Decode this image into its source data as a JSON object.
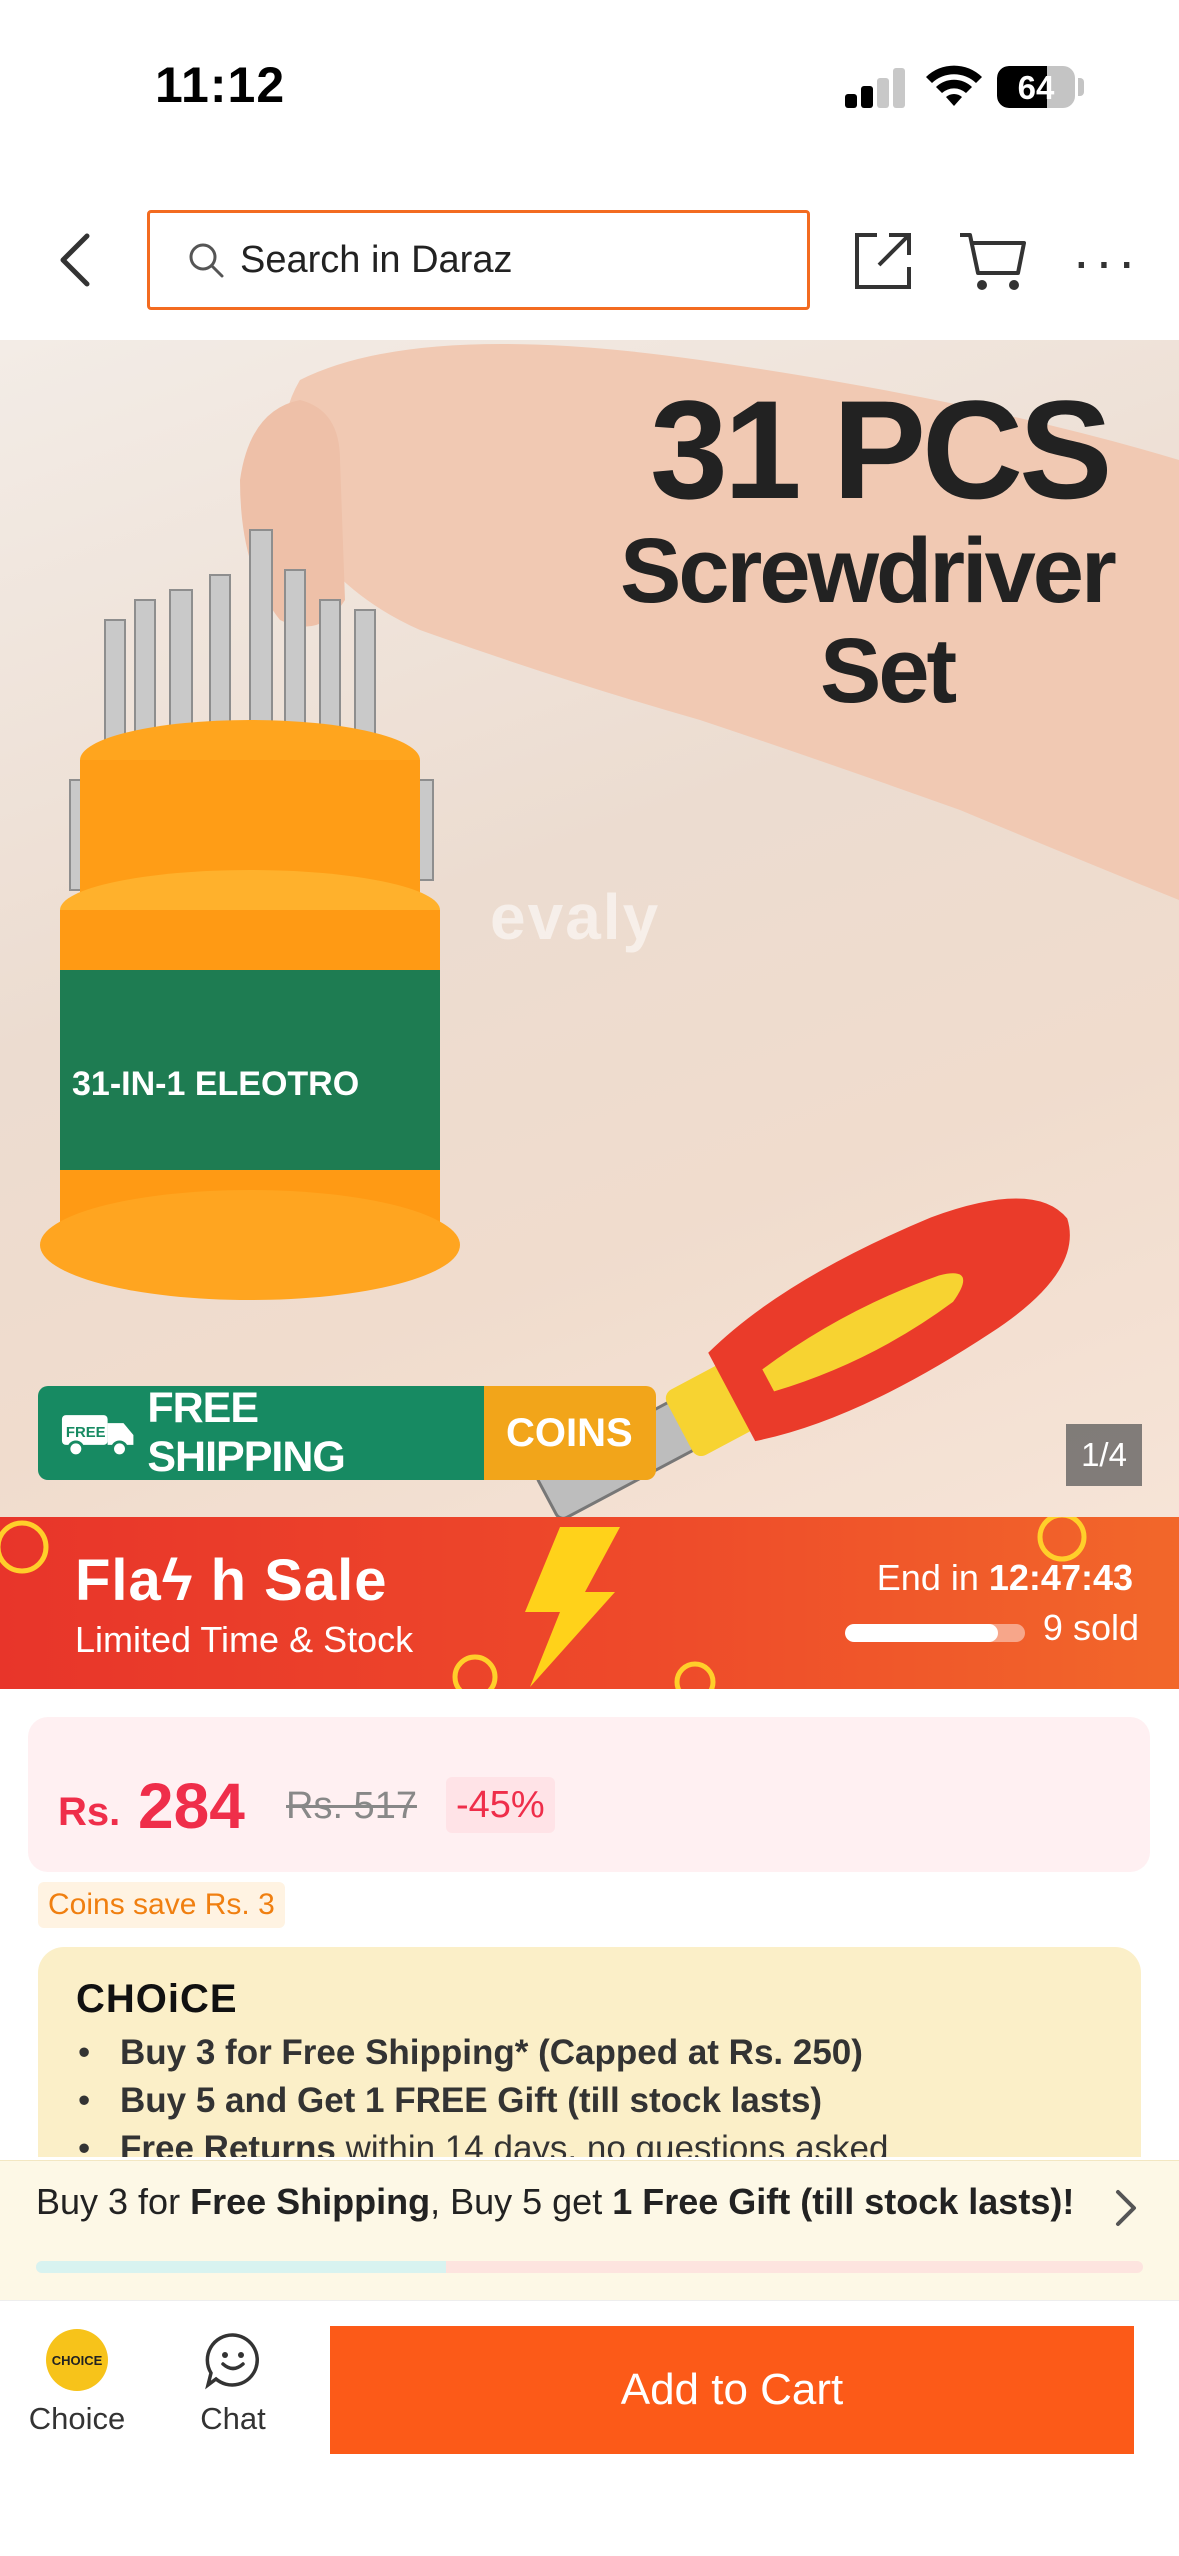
{
  "status_bar": {
    "time": "11:12",
    "battery": "64",
    "battery_level": 0.64
  },
  "header": {
    "search_placeholder": "Search in Daraz"
  },
  "product_image": {
    "title_line1": "31 PCS",
    "title_line2": "Screwdriver",
    "title_line3": "Set",
    "watermark": "evaly",
    "shipping_tag": "FREE SHIPPING",
    "truck_tag": "FREE",
    "coins_tag": "COINS",
    "counter": "1/4"
  },
  "flash_sale": {
    "title": "Flaϟ h Sale",
    "subtitle": "Limited Time & Stock",
    "end_label": "End in",
    "countdown": "12:47:43",
    "sold": "9 sold",
    "sold_progress": 0.85
  },
  "price": {
    "currency": "Rs.",
    "current": "284",
    "original": "Rs. 517",
    "discount": "-45%"
  },
  "coins_save": "Coins save Rs. 3",
  "choice": {
    "logo": "CHOiCE",
    "items": [
      {
        "bold": "Buy 3 for  Free Shipping* (Capped at Rs. 250)",
        "rest": ""
      },
      {
        "bold": "Buy 5 and Get 1 FREE Gift (till stock lasts)",
        "rest": ""
      },
      {
        "bold": "Free Returns",
        "rest": " within 14 days, no questions asked"
      }
    ]
  },
  "promo": {
    "p1": "Buy 3 for ",
    "b1": "Free Shipping",
    "p2": ", Buy 5 get ",
    "b2": "1 Free Gift (till stock lasts)!",
    "progress": 0.37
  },
  "bottom_bar": {
    "choice_label": "Choice",
    "choice_badge": "CHOICE",
    "chat_label": "Chat",
    "add_to_cart": "Add to Cart"
  },
  "colors": {
    "accent": "#fc5a18",
    "price_red": "#ef2e4a",
    "shipping_green": "#178a62",
    "coins_yellow": "#f2a51a"
  }
}
